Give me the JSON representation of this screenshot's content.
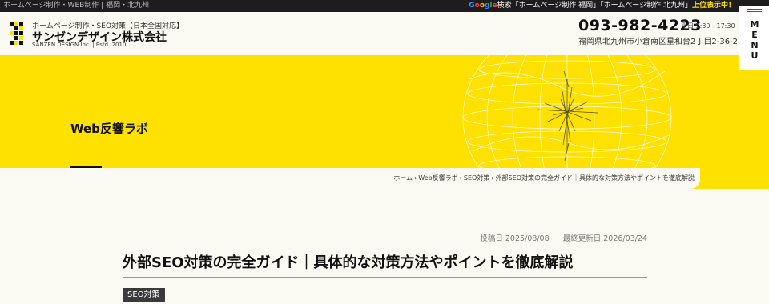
{
  "topbar": {
    "left_text": "ホームページ制作・WEB制作 | 福岡・北九州",
    "google": [
      "G",
      "o",
      "o",
      "g",
      "l",
      "e"
    ],
    "search_text": "検索「ホームページ制作 福岡」「ホームページ制作 北九州」",
    "highlight": "上位表示中！"
  },
  "brand": {
    "subtitle": "ホームページ制作・SEO対策【日本全国対応】",
    "name": "サンゼンデザイン株式会社",
    "english": "SANZEN DESIGN Inc. | Estd. 2010"
  },
  "contact": {
    "phone": "093-982-4223",
    "hours": "平日 9:30 - 17:30",
    "address": "福岡県北九州市小倉南区星和台2丁目2-36-2"
  },
  "menu": {
    "label": "MENU"
  },
  "hero": {
    "title": "Web反響ラボ"
  },
  "breadcrumb": [
    "ホーム",
    "Web反響ラボ",
    "SEO対策",
    "外部SEO対策の完全ガイド｜具体的な対策方法やポイントを徹底解説"
  ],
  "breadcrumb_sep": "›",
  "article": {
    "posted_label": "投稿日",
    "posted_date": "2025/08/08",
    "updated_label": "最終更新日",
    "updated_date": "2026/03/24",
    "title": "外部SEO対策の完全ガイド｜具体的な対策方法やポイントを徹底解説",
    "category_tag": "SEO対策"
  },
  "colors": {
    "accent_yellow": "#ffe100",
    "dark": "#1e1c1c",
    "background": "#fbfaf2"
  },
  "icons": {
    "logo": "logo-mark-icon",
    "menu": "hamburger-icon",
    "hero": "wireframe-globe-icon"
  }
}
